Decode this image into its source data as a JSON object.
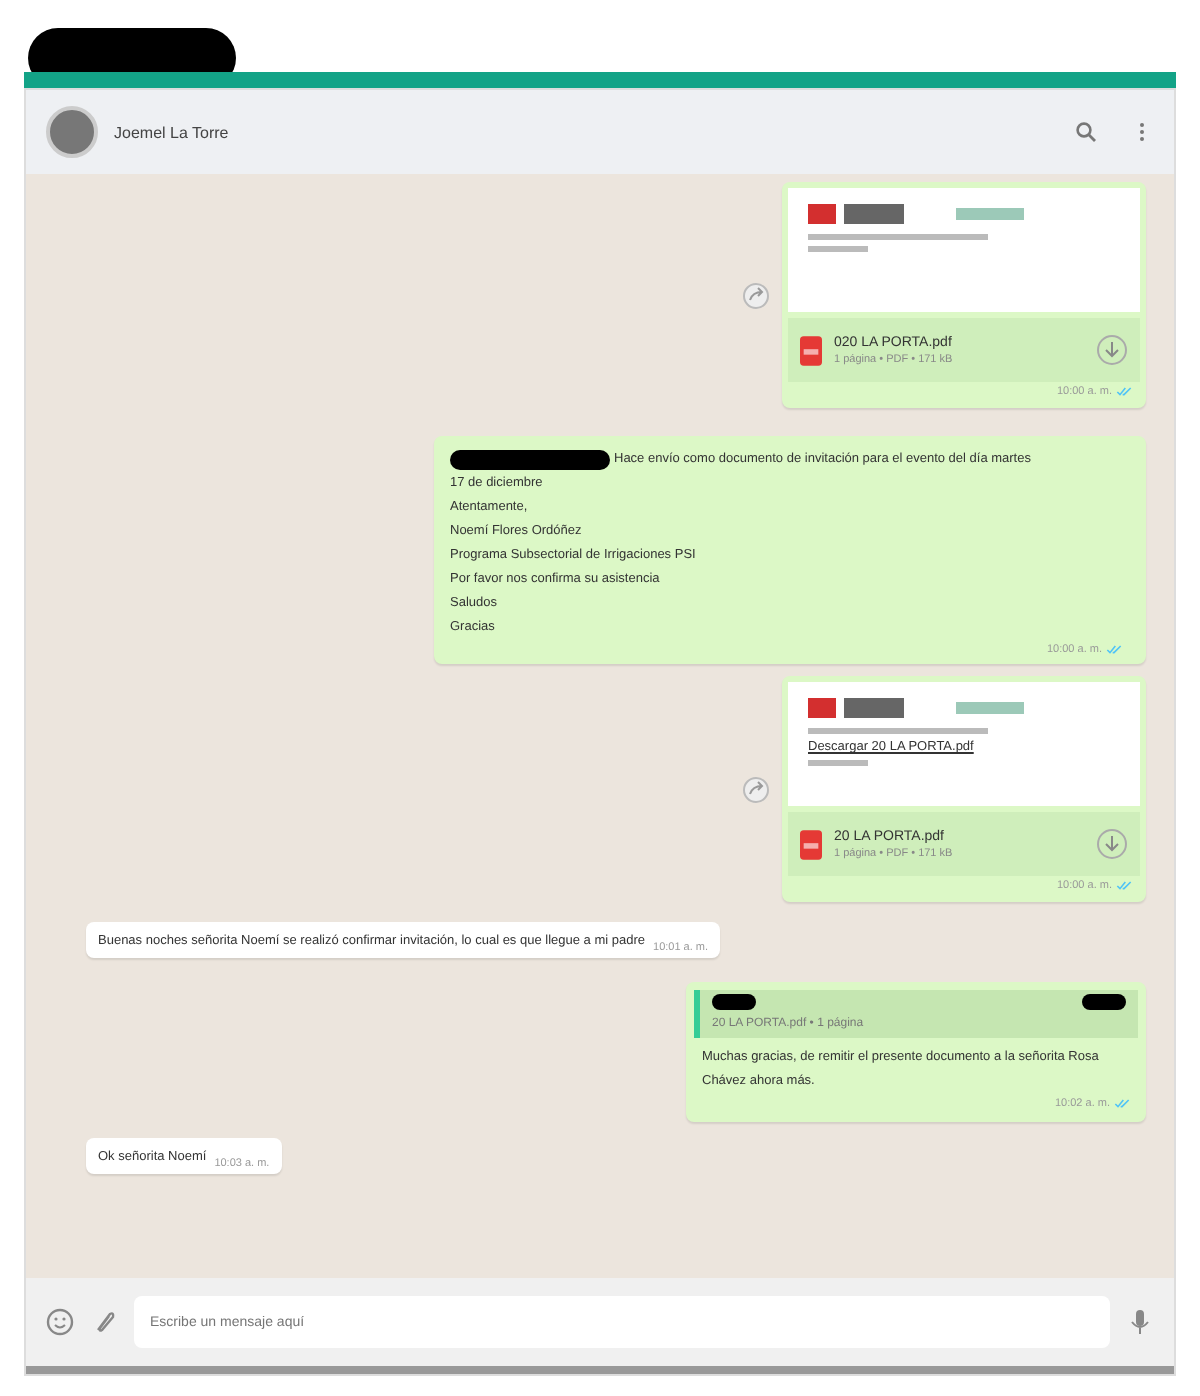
{
  "contact": {
    "name": "Joemel La Torre"
  },
  "messages": [
    {
      "kind": "document",
      "outgoing": true,
      "file_name": "020 LA PORTA.pdf",
      "file_meta": "1 página • PDF • 171 kB",
      "time": "10:00 a. m."
    },
    {
      "kind": "text",
      "outgoing": true,
      "lines": [
        "Hace envío como documento de invitación para el evento del día martes",
        "17 de diciembre",
        "Atentamente,",
        "Noemí Flores Ordóñez",
        "Programa Subsectorial de Irrigaciones PSI",
        "Por favor nos confirma su asistencia",
        "Saludos",
        "Gracias"
      ],
      "time": "10:00 a. m."
    },
    {
      "kind": "document",
      "outgoing": true,
      "preview_caption": "Descargar 20 LA PORTA.pdf",
      "file_name": "20 LA PORTA.pdf",
      "file_meta": "1 página • PDF • 171 kB",
      "time": "10:00 a. m."
    },
    {
      "kind": "text",
      "outgoing": false,
      "lines": [
        "Buenas noches señorita Noemí se realizó confirmar invitación, lo cual es que llegue a mi padre"
      ],
      "time": "10:01 a. m."
    },
    {
      "kind": "reply",
      "outgoing": true,
      "quote": "20 LA PORTA.pdf • 1 página",
      "lines": [
        "Muchas gracias, de remitir el presente documento a la señorita Rosa",
        "Chávez ahora más."
      ],
      "time": "10:02 a. m."
    },
    {
      "kind": "text",
      "outgoing": false,
      "lines": [
        "Ok señorita Noemí"
      ],
      "time": "10:03 a. m."
    }
  ],
  "composer": {
    "placeholder": "Escribe un mensaje aquí"
  }
}
